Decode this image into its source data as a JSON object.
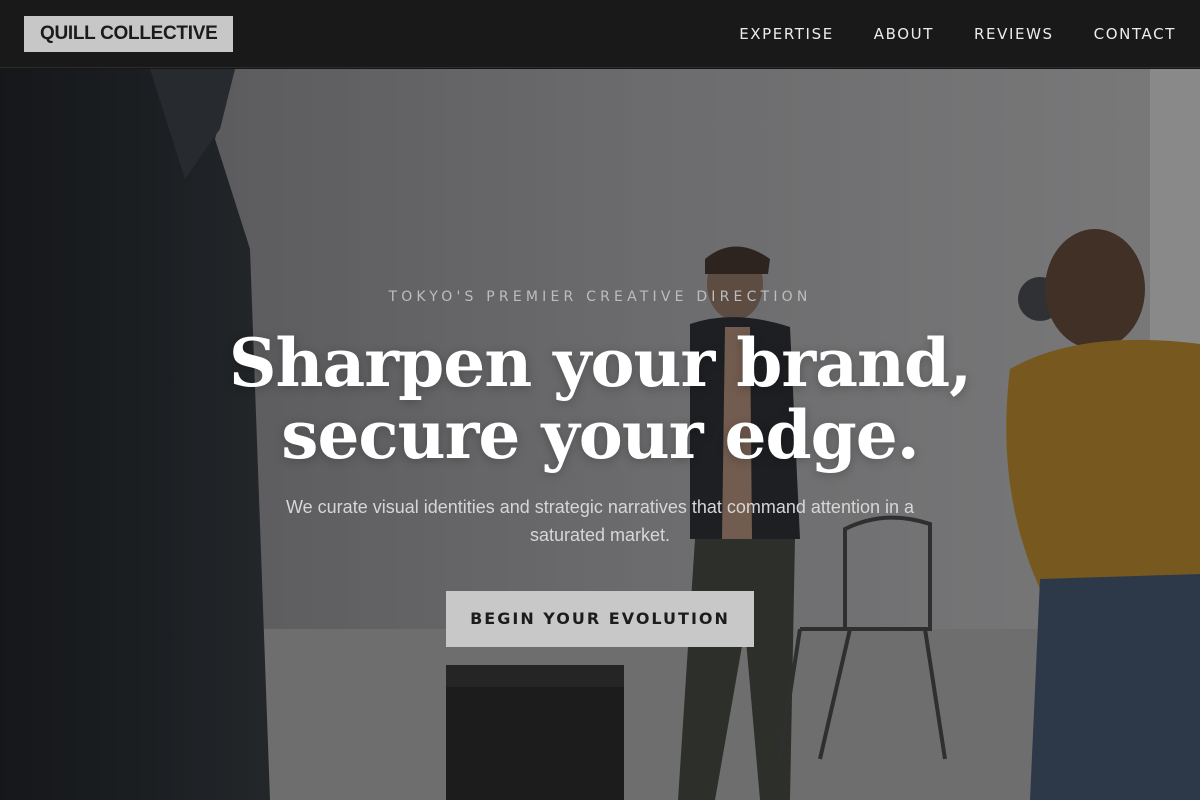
{
  "header": {
    "brand": "QUILL COLLECTIVE",
    "nav": [
      {
        "label": "EXPERTISE"
      },
      {
        "label": "ABOUT"
      },
      {
        "label": "REVIEWS"
      },
      {
        "label": "CONTACT"
      }
    ]
  },
  "hero": {
    "eyebrow": "TOKYO'S PREMIER CREATIVE DIRECTION",
    "headline_line1": "Sharpen your brand,",
    "headline_line2": "secure your edge.",
    "subtext": "We curate visual identities and strategic narratives that command attention in a saturated market.",
    "cta_label": "BEGIN YOUR EVOLUTION",
    "background_image": "photo-studio-shoot"
  },
  "colors": {
    "header_bg": "#191919",
    "brand_bg": "#c7c7c7",
    "cta_bg": "#c8c8c8",
    "headline": "#ffffff"
  }
}
